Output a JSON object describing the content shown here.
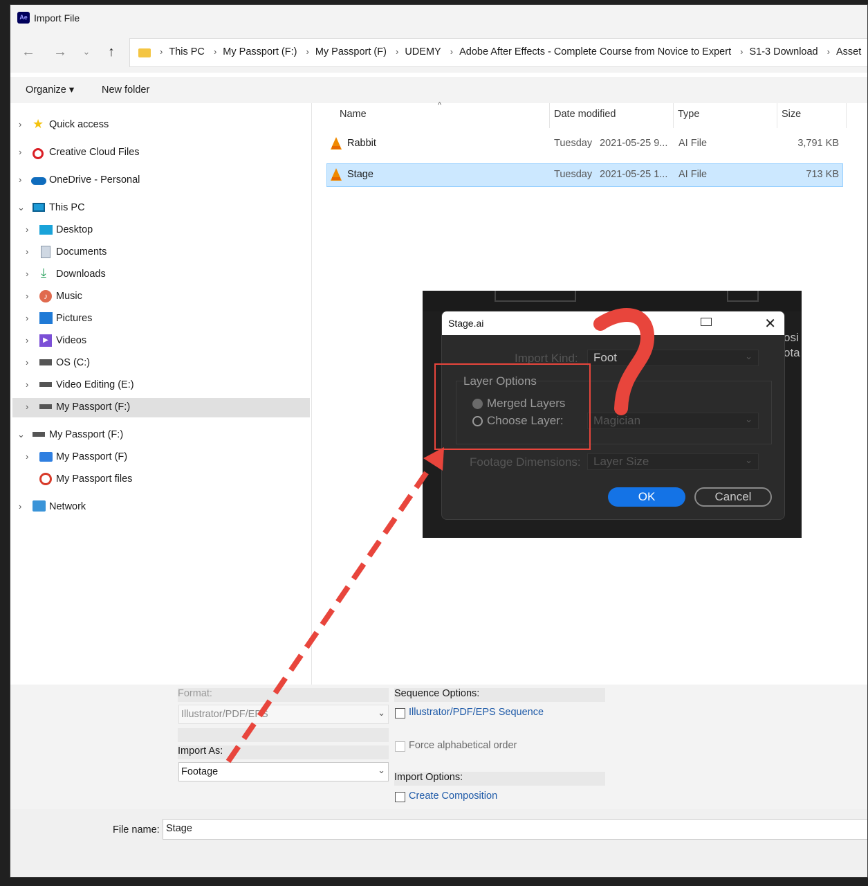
{
  "window": {
    "title": "Import File",
    "app_icon": "Ae"
  },
  "breadcrumb": [
    "This PC",
    "My Passport (F:)",
    "My Passport (F)",
    "UDEMY",
    "Adobe After Effects - Complete Course from Novice to Expert",
    "S1-3 Download",
    "Asset"
  ],
  "toolbar": {
    "organize": "Organize ▾",
    "new_folder": "New folder"
  },
  "sidebar": {
    "quick_access": "Quick access",
    "creative_cloud": "Creative Cloud Files",
    "onedrive": "OneDrive - Personal",
    "this_pc": "This PC",
    "desktop": "Desktop",
    "documents": "Documents",
    "downloads": "Downloads",
    "music": "Music",
    "pictures": "Pictures",
    "videos": "Videos",
    "os_c": "OS (C:)",
    "video_editing": "Video Editing (E:)",
    "my_passport_sel": "My Passport (F:)",
    "my_passport_root": "My Passport (F:)",
    "my_passport_f": "My Passport (F)",
    "my_passport_files": "My Passport files",
    "network": "Network"
  },
  "columns": {
    "name": "Name",
    "date": "Date modified",
    "type": "Type",
    "size": "Size"
  },
  "files": [
    {
      "name": "Rabbit",
      "day": "Tuesday",
      "date": "2021-05-25 9...",
      "type": "AI File",
      "size": "3,791 KB"
    },
    {
      "name": "Stage",
      "day": "Tuesday",
      "date": "2021-05-25 1...",
      "type": "AI File",
      "size": "713 KB"
    }
  ],
  "options": {
    "format_label": "Format:",
    "format_value": "Illustrator/PDF/EPS",
    "import_as_label": "Import As:",
    "import_as_value": "Footage",
    "sequence_label": "Sequence Options:",
    "sequence_checkbox": "Illustrator/PDF/EPS Sequence",
    "force_alpha": "Force alphabetical order",
    "import_options_label": "Import Options:",
    "create_comp": "Create Composition"
  },
  "file_name": {
    "label": "File name:",
    "value": "Stage"
  },
  "ae_dialog": {
    "title": "Stage.ai",
    "import_kind_label": "Import Kind:",
    "import_kind_value": "Foot",
    "layer_options": "Layer Options",
    "merged_layers": "Merged Layers",
    "choose_layer": "Choose Layer:",
    "layer_value": "Magician",
    "footage_dim_label": "Footage Dimensions:",
    "footage_dim_value": "Layer Size",
    "ok": "OK",
    "cancel": "Cancel",
    "bg_text_1": "osi",
    "bg_text_2": "ota"
  },
  "colors": {
    "annotation_red": "#e8453c",
    "accent_blue": "#1473e6",
    "selection": "#cce8ff"
  }
}
